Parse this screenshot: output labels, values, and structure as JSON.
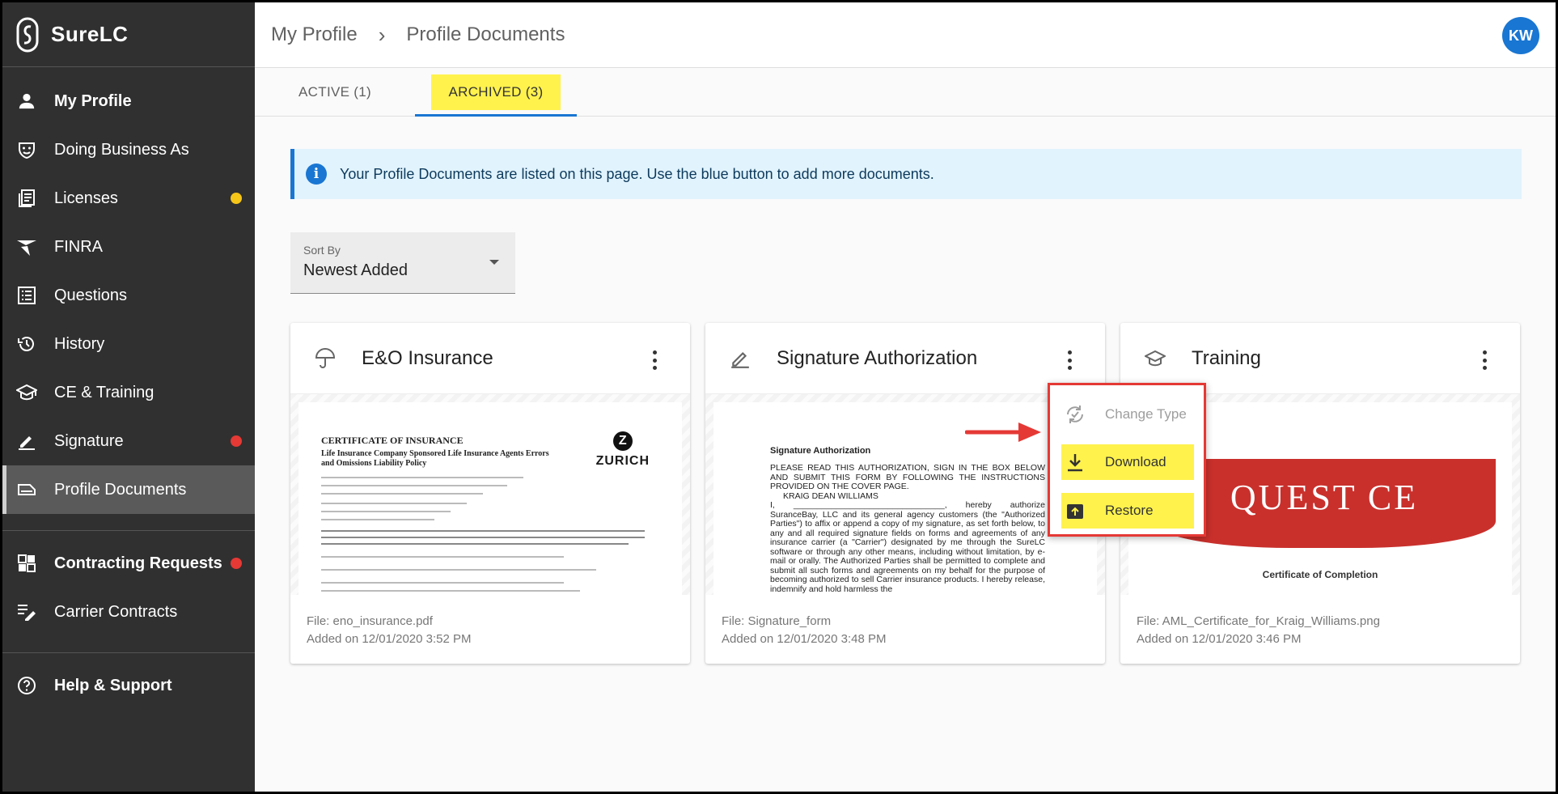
{
  "app": {
    "name": "SureLC"
  },
  "sidebar": {
    "items": [
      {
        "label": "My Profile",
        "icon": "person-icon"
      },
      {
        "label": "Doing Business As",
        "icon": "mask-icon"
      },
      {
        "label": "Licenses",
        "icon": "license-icon",
        "badge": "yellow"
      },
      {
        "label": "FINRA",
        "icon": "finra-icon"
      },
      {
        "label": "Questions",
        "icon": "questions-icon"
      },
      {
        "label": "History",
        "icon": "history-icon"
      },
      {
        "label": "CE & Training",
        "icon": "graduation-cap-icon"
      },
      {
        "label": "Signature",
        "icon": "pen-icon",
        "badge": "red"
      },
      {
        "label": "Profile Documents",
        "icon": "documents-icon"
      }
    ],
    "contracting": {
      "label": "Contracting Requests",
      "badge": "red"
    },
    "carrier": {
      "label": "Carrier Contracts"
    },
    "help": {
      "label": "Help & Support"
    }
  },
  "header": {
    "crumb1": "My Profile",
    "crumb2": "Profile Documents",
    "avatar": "KW"
  },
  "tabs": {
    "active": "ACTIVE (1)",
    "archived": "ARCHIVED (3)"
  },
  "banner": {
    "text": "Your Profile Documents are listed on this page. Use the blue button to add more documents."
  },
  "sort": {
    "label": "Sort By",
    "value": "Newest Added"
  },
  "cards": [
    {
      "title": "E&O Insurance",
      "icon": "umbrella-icon",
      "file": "File: eno_insurance.pdf",
      "added": "Added on 12/01/2020 3:52 PM"
    },
    {
      "title": "Signature Authorization",
      "icon": "pen-icon",
      "file": "File: Signature_form",
      "added": "Added on 12/01/2020 3:48 PM"
    },
    {
      "title": "Training",
      "icon": "graduation-cap-icon",
      "file": "File: AML_Certificate_for_Kraig_Williams.png",
      "added": "Added on 12/01/2020 3:46 PM"
    }
  ],
  "previews": {
    "eno": {
      "title": "CERTIFICATE OF INSURANCE",
      "subtitle": "Life Insurance Company Sponsored Life Insurance Agents Errors and Omissions Liability Policy",
      "logo": "ZURICH"
    },
    "sig": {
      "title": "Signature Authorization",
      "body": "PLEASE READ THIS AUTHORIZATION, SIGN IN THE BOX BELOW AND SUBMIT THIS FORM BY FOLLOWING THE INSTRUCTIONS PROVIDED ON THE COVER PAGE.",
      "name": "KRAIG DEAN WILLIAMS",
      "body2": "I, ________________________________, hereby authorize SuranceBay, LLC and its general agency customers (the \"Authorized Parties\") to affix or append a copy of my signature, as set forth below, to any and all required signature fields on forms and agreements of any insurance carrier (a \"Carrier\") designated by me through the SureLC software or through any other means, including without limitation, by e-mail or orally. The Authorized Parties shall be permitted to complete and submit all such forms and agreements on my behalf for the purpose of becoming authorized to sell Carrier insurance products. I hereby release, indemnify and hold harmless the"
    },
    "training": {
      "banner": "QUEST CE",
      "caption": "Certificate of Completion"
    }
  },
  "menu": {
    "change_type": "Change Type",
    "download": "Download",
    "restore": "Restore"
  },
  "colors": {
    "accent": "#1976d2",
    "highlight": "#fff24d",
    "annotation": "#e53935",
    "sidebar": "#303030"
  }
}
